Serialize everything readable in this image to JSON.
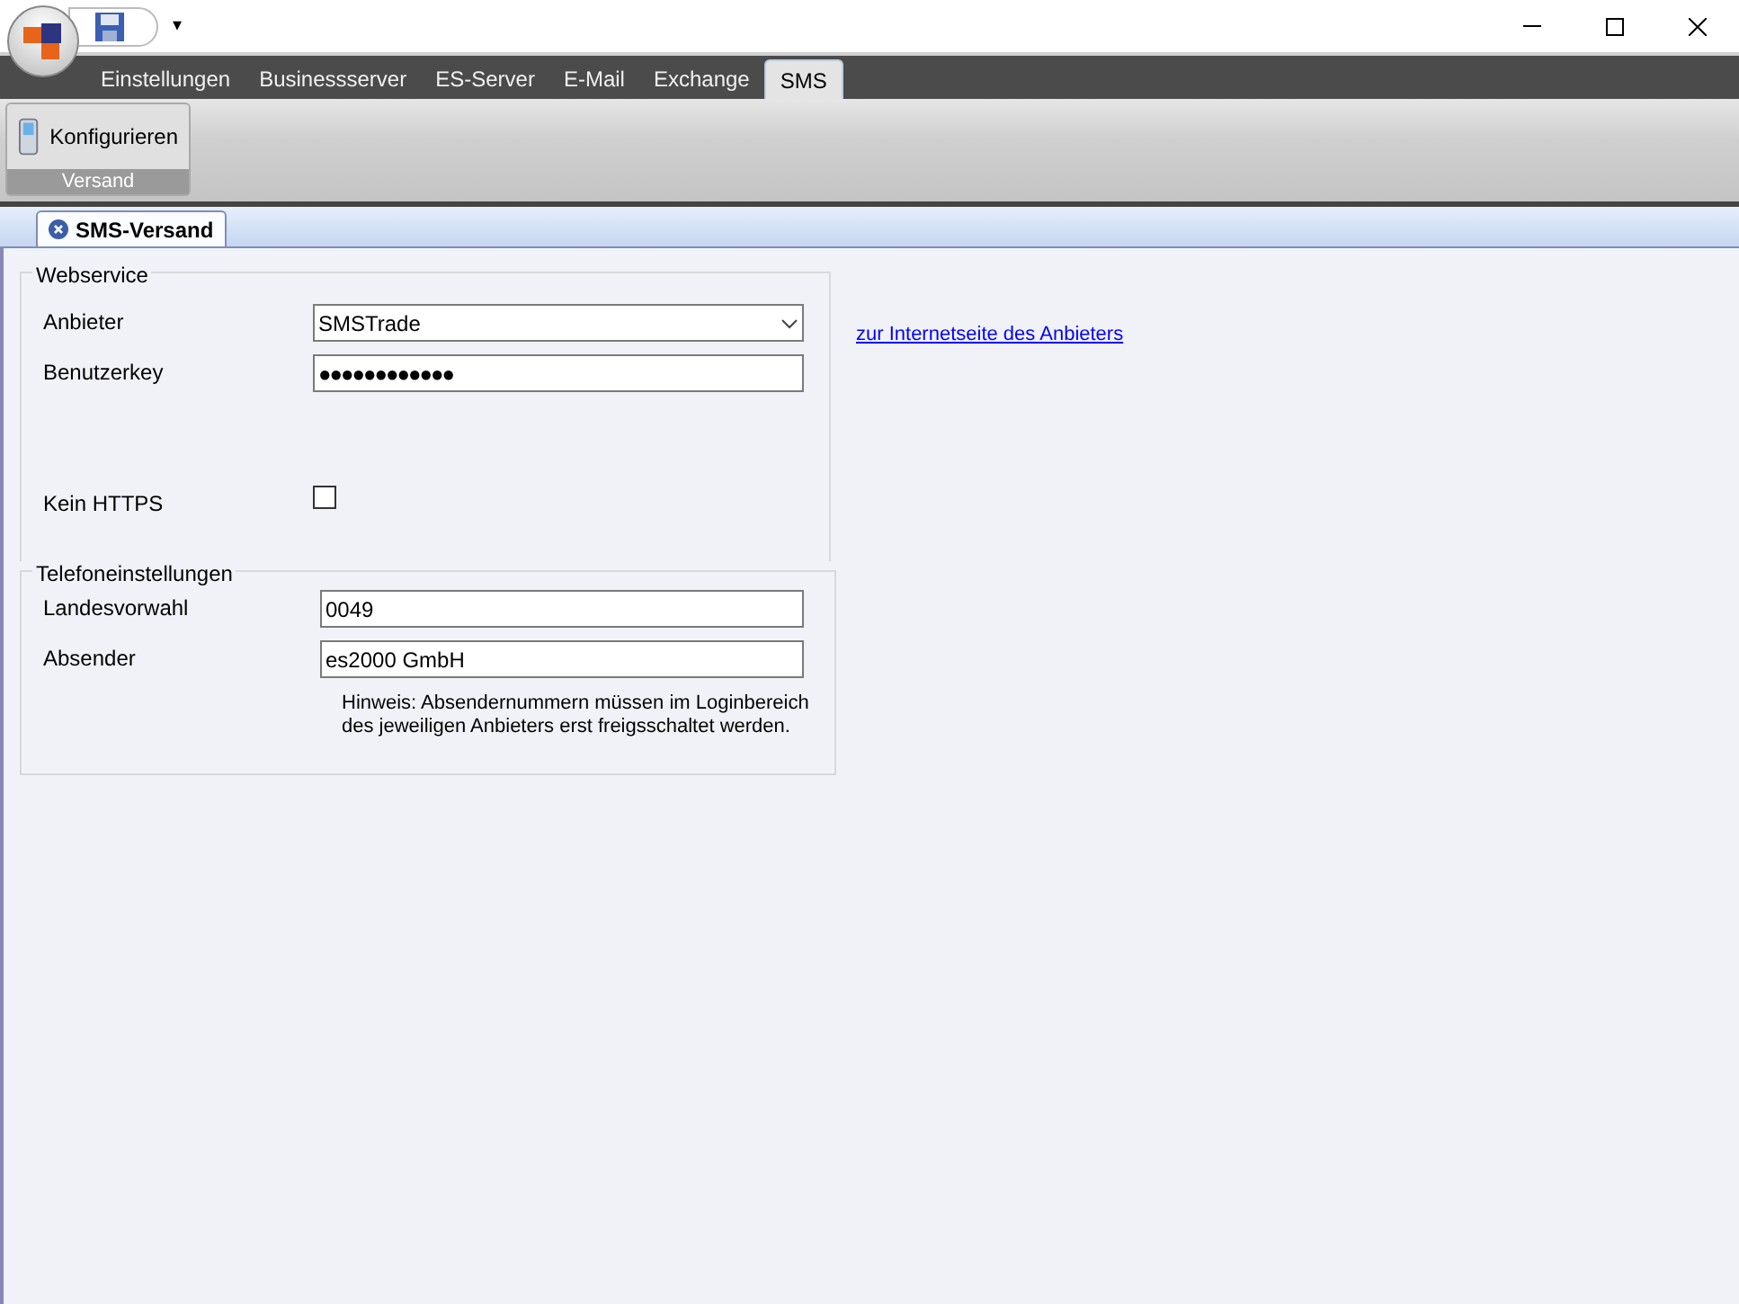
{
  "quick_access": {
    "menu_glyph": "▾"
  },
  "ribbon_tabs": [
    {
      "label": "Einstellungen",
      "selected": false
    },
    {
      "label": "Businessserver",
      "selected": false
    },
    {
      "label": "ES-Server",
      "selected": false
    },
    {
      "label": "E-Mail",
      "selected": false
    },
    {
      "label": "Exchange",
      "selected": false
    },
    {
      "label": "SMS",
      "selected": true
    }
  ],
  "ribbon_group": {
    "button": "Konfigurieren",
    "label": "Versand"
  },
  "document_tab": {
    "label": "SMS-Versand"
  },
  "webservice": {
    "title": "Webservice",
    "fields": [
      {
        "kind": "dropdown",
        "label": "Anbieter",
        "value": "SMSTrade"
      },
      {
        "kind": "password",
        "label": "Benutzerkey",
        "value": "●●●●●●●●●●●●"
      },
      {
        "kind": "checkbox",
        "label": "Kein HTTPS",
        "checked": false
      }
    ],
    "link": "zur Internetseite des Anbieters"
  },
  "telefon": {
    "title": "Telefoneinstellungen",
    "fields": [
      {
        "kind": "text",
        "label": "Landesvorwahl",
        "value": "0049"
      },
      {
        "kind": "text",
        "label": "Absender",
        "value": "es2000 GmbH"
      }
    ],
    "hint": "Hinweis: Absendernummern müssen im Loginbereich des jeweiligen Anbieters erst freigsschaltet werden."
  }
}
